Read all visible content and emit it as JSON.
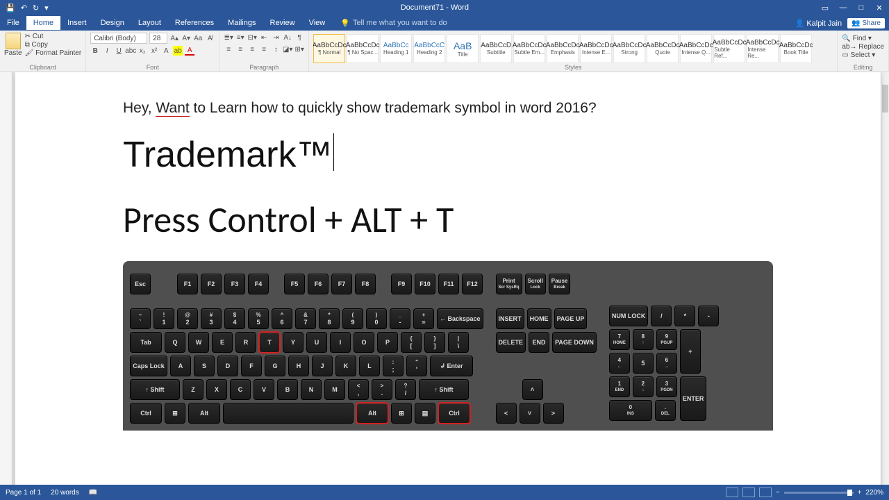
{
  "titlebar": {
    "title": "Document71 - Word",
    "user": "Kalpit Jain",
    "share": "Share"
  },
  "tabs": {
    "file": "File",
    "home": "Home",
    "insert": "Insert",
    "design": "Design",
    "layout": "Layout",
    "references": "References",
    "mailings": "Mailings",
    "review": "Review",
    "view": "View",
    "tellme": "Tell me what you want to do"
  },
  "ribbon": {
    "clipboard": {
      "label": "Clipboard",
      "paste": "Paste",
      "cut": "Cut",
      "copy": "Copy",
      "formatpainter": "Format Painter"
    },
    "font": {
      "label": "Font",
      "name": "Calibri (Body)",
      "size": "28"
    },
    "paragraph": {
      "label": "Paragraph"
    },
    "styles": {
      "label": "Styles",
      "items": [
        {
          "preview": "AaBbCcDc",
          "name": "¶ Normal"
        },
        {
          "preview": "AaBbCcDc",
          "name": "¶ No Spac..."
        },
        {
          "preview": "AaBbCc",
          "name": "Heading 1"
        },
        {
          "preview": "AaBbCcC",
          "name": "Heading 2"
        },
        {
          "preview": "AaB",
          "name": "Title"
        },
        {
          "preview": "AaBbCcD",
          "name": "Subtitle"
        },
        {
          "preview": "AaBbCcDc",
          "name": "Subtle Em..."
        },
        {
          "preview": "AaBbCcDc",
          "name": "Emphasis"
        },
        {
          "preview": "AaBbCcDc",
          "name": "Intense E..."
        },
        {
          "preview": "AaBbCcDc",
          "name": "Strong"
        },
        {
          "preview": "AaBbCcDc",
          "name": "Quote"
        },
        {
          "preview": "AaBbCcDc",
          "name": "Intense Q..."
        },
        {
          "preview": "AaBbCcDc",
          "name": "Subtle Ref..."
        },
        {
          "preview": "AaBbCcDc",
          "name": "Intense Re..."
        },
        {
          "preview": "AaBbCcDc",
          "name": "Book Title"
        }
      ]
    },
    "editing": {
      "label": "Editing",
      "find": "Find",
      "replace": "Replace",
      "select": "Select"
    }
  },
  "document": {
    "line1a": "Hey, ",
    "line1b": "Want",
    "line1c": " to Learn how to quickly show trademark symbol in word 2016?",
    "trademark": "Trademark™",
    "press": "Press Control + ALT + T"
  },
  "keyboard": {
    "fnrow": [
      "Esc",
      "F1",
      "F2",
      "F3",
      "F4",
      "F5",
      "F6",
      "F7",
      "F8",
      "F9",
      "F10",
      "F11",
      "F12"
    ],
    "sysrow": [
      "Print\nScr\nSysRq",
      "Scroll\nLock",
      "Pause\nBreak"
    ],
    "row1": [
      [
        "~",
        "`"
      ],
      [
        "!",
        "1"
      ],
      [
        "@",
        "2"
      ],
      [
        "#",
        "3"
      ],
      [
        "$",
        "4"
      ],
      [
        "%",
        "5"
      ],
      [
        "^",
        "6"
      ],
      [
        "&",
        "7"
      ],
      [
        "*",
        "8"
      ],
      [
        "(",
        "9"
      ],
      [
        ")",
        "0"
      ],
      [
        "_",
        "-"
      ],
      [
        "+",
        "="
      ]
    ],
    "backspace": "Backspace",
    "nav1": [
      "INSERT",
      "HOME",
      "PAGE\nUP"
    ],
    "num1": [
      "NUM\nLOCK",
      "/",
      "*",
      "-"
    ],
    "row2": [
      "Q",
      "W",
      "E",
      "R",
      "T",
      "Y",
      "U",
      "I",
      "O",
      "P",
      [
        "{",
        "["
      ],
      [
        "}",
        "]"
      ],
      [
        "|",
        "\\"
      ]
    ],
    "tab": "Tab",
    "nav2": [
      "DELETE",
      "END",
      "PAGE\nDOWN"
    ],
    "num2": [
      [
        "7",
        "HOME"
      ],
      [
        "8",
        "↑"
      ],
      [
        "9",
        "PGUP"
      ]
    ],
    "numplus": "+",
    "row3": [
      "A",
      "S",
      "D",
      "F",
      "G",
      "H",
      "J",
      "K",
      "L",
      [
        ":",
        ";"
      ],
      [
        "\"",
        "'"
      ]
    ],
    "caps": "Caps Lock",
    "enter": "Enter",
    "num3": [
      [
        "4",
        "←"
      ],
      [
        "5",
        ""
      ],
      [
        "6",
        "→"
      ]
    ],
    "row4": [
      "Z",
      "X",
      "C",
      "V",
      "B",
      "N",
      "M",
      [
        "<",
        ","
      ],
      [
        ">",
        "."
      ],
      [
        "?",
        "/"
      ]
    ],
    "shift": "Shift",
    "arrowup": "˄",
    "num4": [
      [
        "1",
        "END"
      ],
      [
        "2",
        "↓"
      ],
      [
        "3",
        "PGDN"
      ]
    ],
    "numenter": "ENTER",
    "row5": {
      "ctrl": "Ctrl",
      "alt": "Alt"
    },
    "arrows": [
      "<",
      "˅",
      ">"
    ],
    "num5": [
      [
        "0",
        "INS"
      ],
      [
        ".",
        "DEL"
      ]
    ]
  },
  "status": {
    "page": "Page 1 of 1",
    "words": "20 words",
    "zoom": "220%"
  }
}
